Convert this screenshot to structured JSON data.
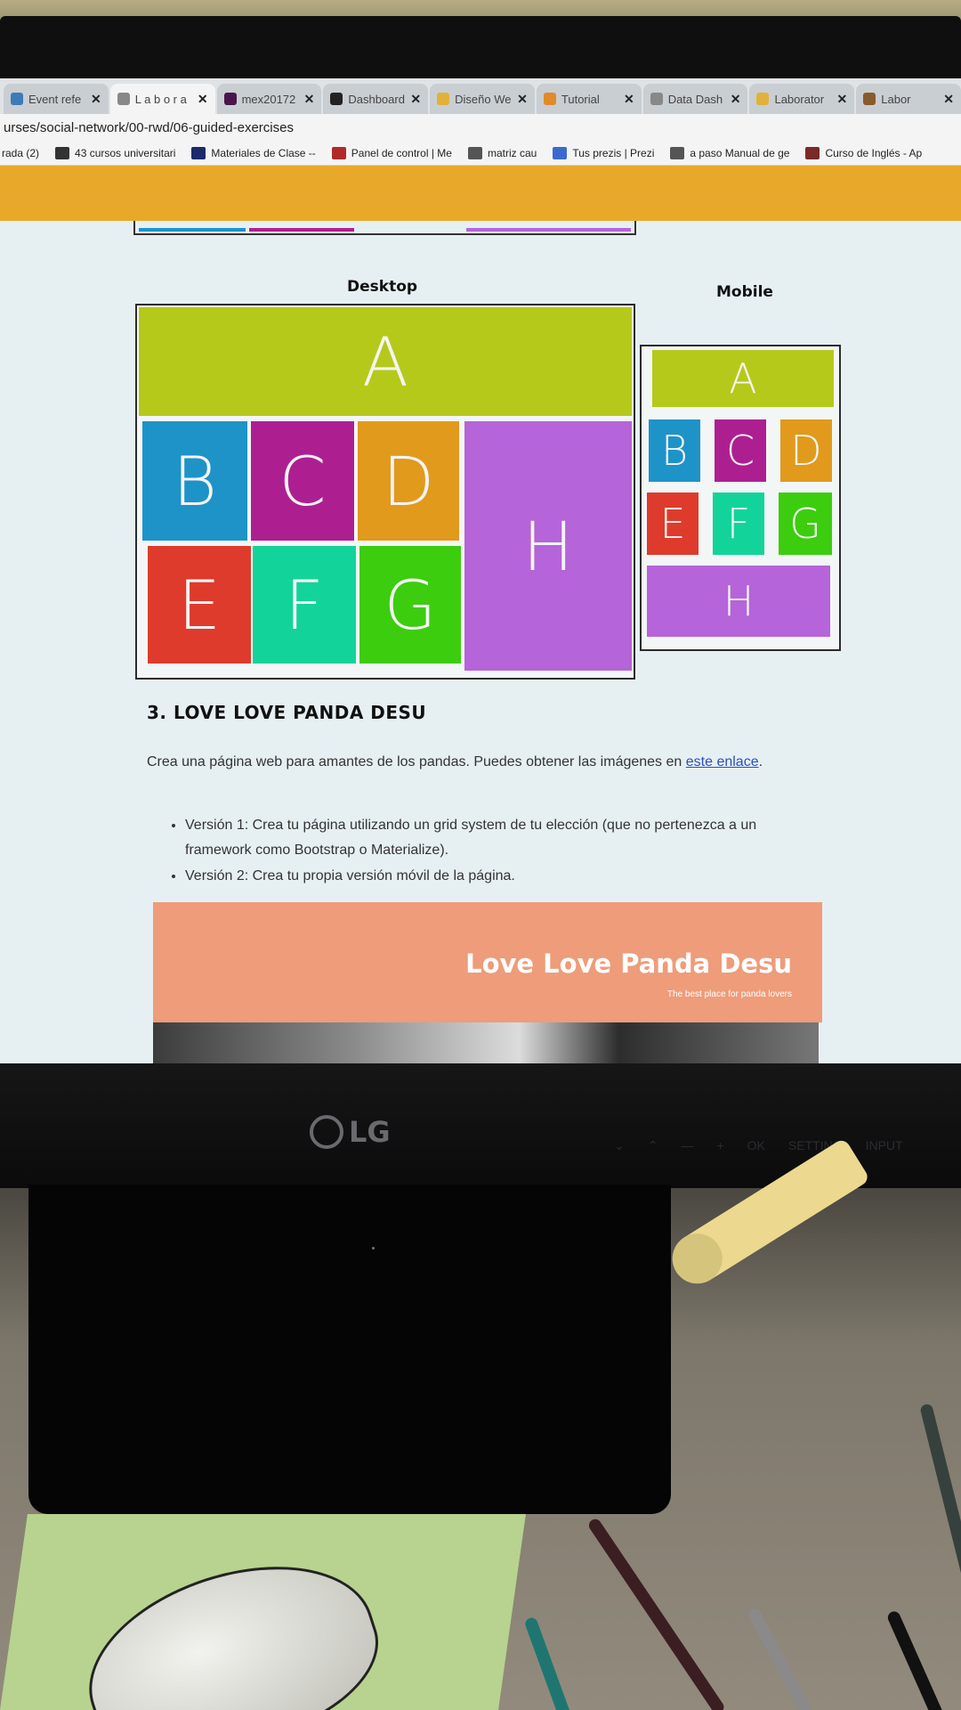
{
  "browser": {
    "tabs": [
      {
        "title": "Event refe",
        "favicon": "wordpress-icon",
        "color": "#3c7bb6",
        "active": false
      },
      {
        "title": "L a b o r a",
        "favicon": "document-icon",
        "color": "#888888",
        "active": true
      },
      {
        "title": "mex20172",
        "favicon": "slack-hash-icon",
        "color": "#4a154b",
        "active": false
      },
      {
        "title": "Dashboard",
        "favicon": "github-icon",
        "color": "#222222",
        "active": false
      },
      {
        "title": "Diseño We",
        "favicon": "google-drive-icon",
        "color": "#e0b23a",
        "active": false
      },
      {
        "title": "Tutorial",
        "favicon": "orange-icon",
        "color": "#e08a2a",
        "active": false
      },
      {
        "title": "Data Dash",
        "favicon": "document-icon",
        "color": "#888888",
        "active": false
      },
      {
        "title": "Laborator",
        "favicon": "folder-icon",
        "color": "#e0b23a",
        "active": false
      },
      {
        "title": "Labor",
        "favicon": "brown-square-icon",
        "color": "#8a5a2a",
        "active": false
      }
    ],
    "address": "urses/social-network/00-rwd/06-guided-exercises",
    "bookmarks": [
      {
        "label": "rada (2)",
        "icon": "none",
        "color": ""
      },
      {
        "label": "43 cursos universitari",
        "icon": "book-icon",
        "color": "#333333"
      },
      {
        "label": "Materiales de Clase --",
        "icon": "uc-logo-icon",
        "color": "#1a2a6a"
      },
      {
        "label": "Panel de control | Me",
        "icon": "mx-logo-icon",
        "color": "#b02a2a"
      },
      {
        "label": "matriz cau",
        "icon": "tree-icon",
        "color": "#555555"
      },
      {
        "label": "Tus prezis | Prezi",
        "icon": "prezi-icon",
        "color": "#3a6ad0"
      },
      {
        "label": "a paso Manual de ge",
        "icon": "dots-icon",
        "color": "#555555"
      },
      {
        "label": "Curso de Inglés - Ap",
        "icon": "square-icon",
        "color": "#7a2a2a"
      }
    ],
    "bar_color": "#e8a92a"
  },
  "figure": {
    "desktop_label": "Desktop",
    "mobile_label": "Mobile",
    "desktop_cells": [
      {
        "letter": "A",
        "color": "#b5c91a"
      },
      {
        "letter": "B",
        "color": "#1e93c8"
      },
      {
        "letter": "C",
        "color": "#ad1f91"
      },
      {
        "letter": "D",
        "color": "#e19a1c"
      },
      {
        "letter": "H",
        "color": "#b564d9"
      },
      {
        "letter": "E",
        "color": "#de3b2d"
      },
      {
        "letter": "F",
        "color": "#12d49a"
      },
      {
        "letter": "G",
        "color": "#3ccd0f"
      }
    ],
    "mobile_cells": [
      {
        "letter": "A",
        "color": "#b5c91a"
      },
      {
        "letter": "B",
        "color": "#1e93c8"
      },
      {
        "letter": "C",
        "color": "#ad1f91"
      },
      {
        "letter": "D",
        "color": "#e19a1c"
      },
      {
        "letter": "E",
        "color": "#de3b2d"
      },
      {
        "letter": "F",
        "color": "#12d49a"
      },
      {
        "letter": "G",
        "color": "#3ccd0f"
      },
      {
        "letter": "H",
        "color": "#b564d9"
      }
    ]
  },
  "content": {
    "section_title": "3. LOVE LOVE PANDA DESU",
    "paragraph_text": "Crea una página web para amantes de los pandas. Puedes obtener las imágenes en ",
    "paragraph_link": "este enlace",
    "paragraph_end": ".",
    "bullets": [
      "Versión 1: Crea tu página utilizando un grid system de tu elección (que no pertenezca a un framework como Bootstrap o Materialize).",
      "Versión 2: Crea tu propia versión móvil de la página."
    ]
  },
  "panda_preview": {
    "title": "Love Love Panda Desu",
    "subtitle": "The best place for panda lovers",
    "color": "#ee9c7a"
  },
  "monitor": {
    "brand": "LG",
    "buttons": [
      "⌄",
      "⌃",
      "—",
      "+",
      "OK",
      "SETTING",
      "INPUT"
    ]
  }
}
